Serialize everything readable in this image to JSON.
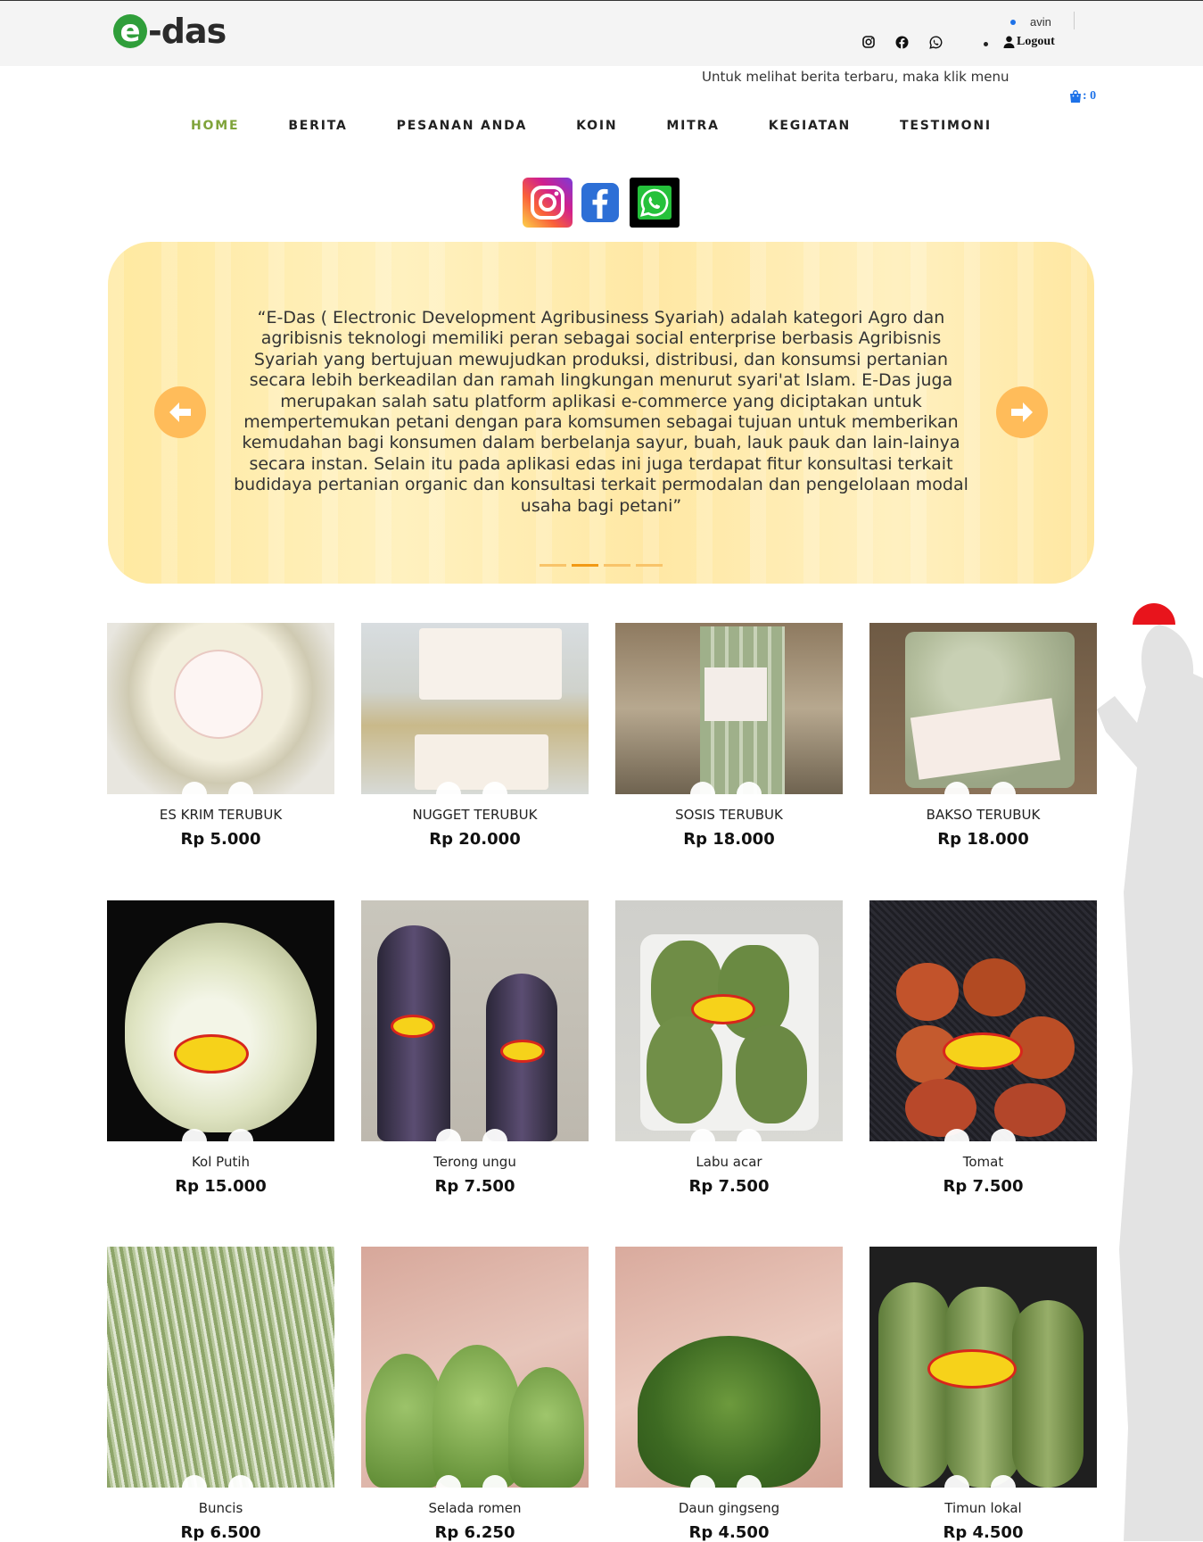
{
  "header": {
    "logo_mark": "e",
    "logo_text": "-das",
    "user_name": "avin",
    "logout_label": "Logout",
    "social_icons": [
      "instagram-icon",
      "facebook-icon",
      "whatsapp-icon"
    ]
  },
  "marquee": "Untuk melihat berita terbaru, maka klik menu ber",
  "cart": {
    "label": ": 0"
  },
  "nav": [
    {
      "label": "HOME",
      "active": true
    },
    {
      "label": "BERITA"
    },
    {
      "label": "PESANAN ANDA"
    },
    {
      "label": "KOIN"
    },
    {
      "label": "MITRA"
    },
    {
      "label": "KEGIATAN"
    },
    {
      "label": "TESTIMONI"
    }
  ],
  "hero": {
    "text": "“E-Das ( Electronic Development Agribusiness Syariah) adalah kategori Agro dan agribisnis teknologi memiliki peran sebagai social enterprise berbasis Agribisnis Syariah yang bertujuan mewujudkan produksi, distribusi, dan konsumsi pertanian secara lebih berkeadilan dan ramah lingkungan menurut syari'at Islam. E-Das juga merupakan salah satu platform aplikasi e-commerce yang diciptakan untuk mempertemukan petani dengan para komsumen sebagai tujuan untuk memberikan kemudahan bagi konsumen dalam berbelanja sayur, buah, lauk pauk dan lain-lainya secara instan. Selain itu pada aplikasi edas ini juga terdapat fitur konsultasi terkait budidaya pertanian organic dan konsultasi terkait permodalan dan pengelolaan modal usaha bagi petani”",
    "slide_count": 4,
    "active_slide": 2
  },
  "products": [
    {
      "name": "ES KRIM TERUBUK",
      "price": "Rp 5.000"
    },
    {
      "name": "NUGGET TERUBUK",
      "price": "Rp 20.000"
    },
    {
      "name": "SOSIS TERUBUK",
      "price": "Rp 18.000"
    },
    {
      "name": "BAKSO TERUBUK",
      "price": "Rp 18.000"
    },
    {
      "name": "Kol Putih",
      "price": "Rp 15.000"
    },
    {
      "name": "Terong ungu",
      "price": "Rp 7.500"
    },
    {
      "name": "Labu acar",
      "price": "Rp 7.500"
    },
    {
      "name": "Tomat",
      "price": "Rp 7.500"
    },
    {
      "name": "Buncis",
      "price": "Rp 6.500"
    },
    {
      "name": "Selada romen",
      "price": "Rp 6.250"
    },
    {
      "name": "Daun gingseng",
      "price": "Rp 4.500"
    },
    {
      "name": "Timun lokal",
      "price": "Rp 4.500"
    }
  ],
  "colors": {
    "accent_green": "#7fa33a",
    "cart_blue": "#1e72e8",
    "hero_yellow": "#ffe9a0",
    "arrow_orange": "#ffbc5a"
  }
}
